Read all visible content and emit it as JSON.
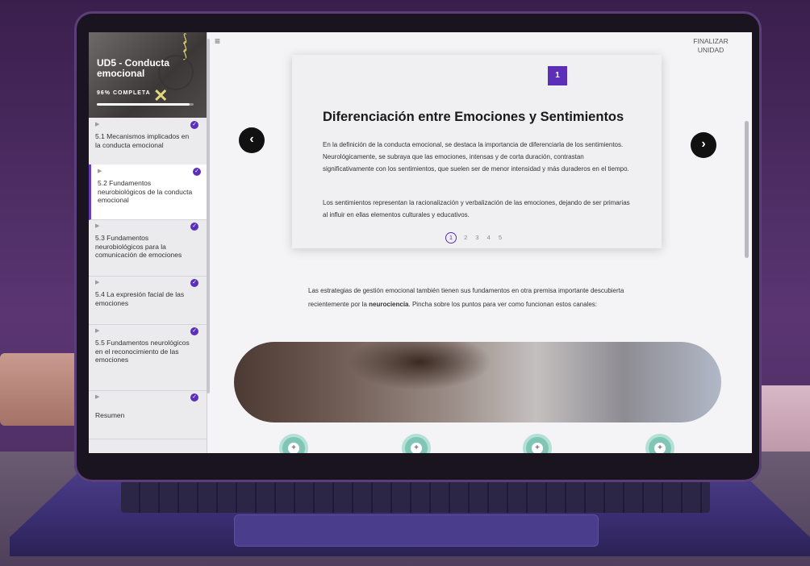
{
  "sidebar": {
    "course_title": "UD5 - Conducta emocional",
    "progress_label": "96% COMPLETA",
    "progress_percent": 96,
    "lessons": [
      {
        "label": "5.1 Mecanismos implicados en la conducta emocional",
        "completed": true
      },
      {
        "label": "5.2 Fundamentos neurobiológicos de la conducta emocional",
        "completed": true
      },
      {
        "label": "5.3 Fundamentos neurobiológicos para la comunicación de emociones",
        "completed": true
      },
      {
        "label": "5.4 La expresión facial de las emociones",
        "completed": true
      },
      {
        "label": "5.5 Fundamentos neurológicos en el reconocimiento de las emociones",
        "completed": true
      },
      {
        "label": "Resumen",
        "completed": true
      }
    ]
  },
  "header": {
    "finalize_label": "FINALIZAR UNIDAD"
  },
  "card": {
    "badge": "1",
    "title": "Diferenciación entre Emociones y Sentimientos",
    "paragraph1": "En la definición de la conducta emocional, se destaca la importancia de diferenciarla de los sentimientos. Neurológicamente, se subraya que las emociones, intensas y de corta duración, contrastan significativamente con los sentimientos, que suelen ser de menor intensidad y más duraderos en el tiempo.",
    "paragraph2": "Los sentimientos representan la racionalización y verbalización de las emociones, dejando de ser primarias al influir en ellas elementos culturales y educativos.",
    "pages": [
      "1",
      "2",
      "3",
      "4",
      "5"
    ],
    "current_page": "1"
  },
  "body": {
    "text_before": "Las estrategias de gestión emocional también tienen sus fundamentos en otra premisa importante descubierta recientemente por la ",
    "text_bold": "neurociencia",
    "text_after": ". Pincha sobre los puntos para ver como funcionan estos canales:"
  },
  "icons": {
    "menu": "hamburger-icon",
    "prev": "chevron-left-icon",
    "next": "chevron-right-icon",
    "check": "check-circle-icon",
    "hotspot": "plus-icon"
  },
  "colors": {
    "accent": "#5b2fb8",
    "hotspot": "#7fc6b6"
  }
}
